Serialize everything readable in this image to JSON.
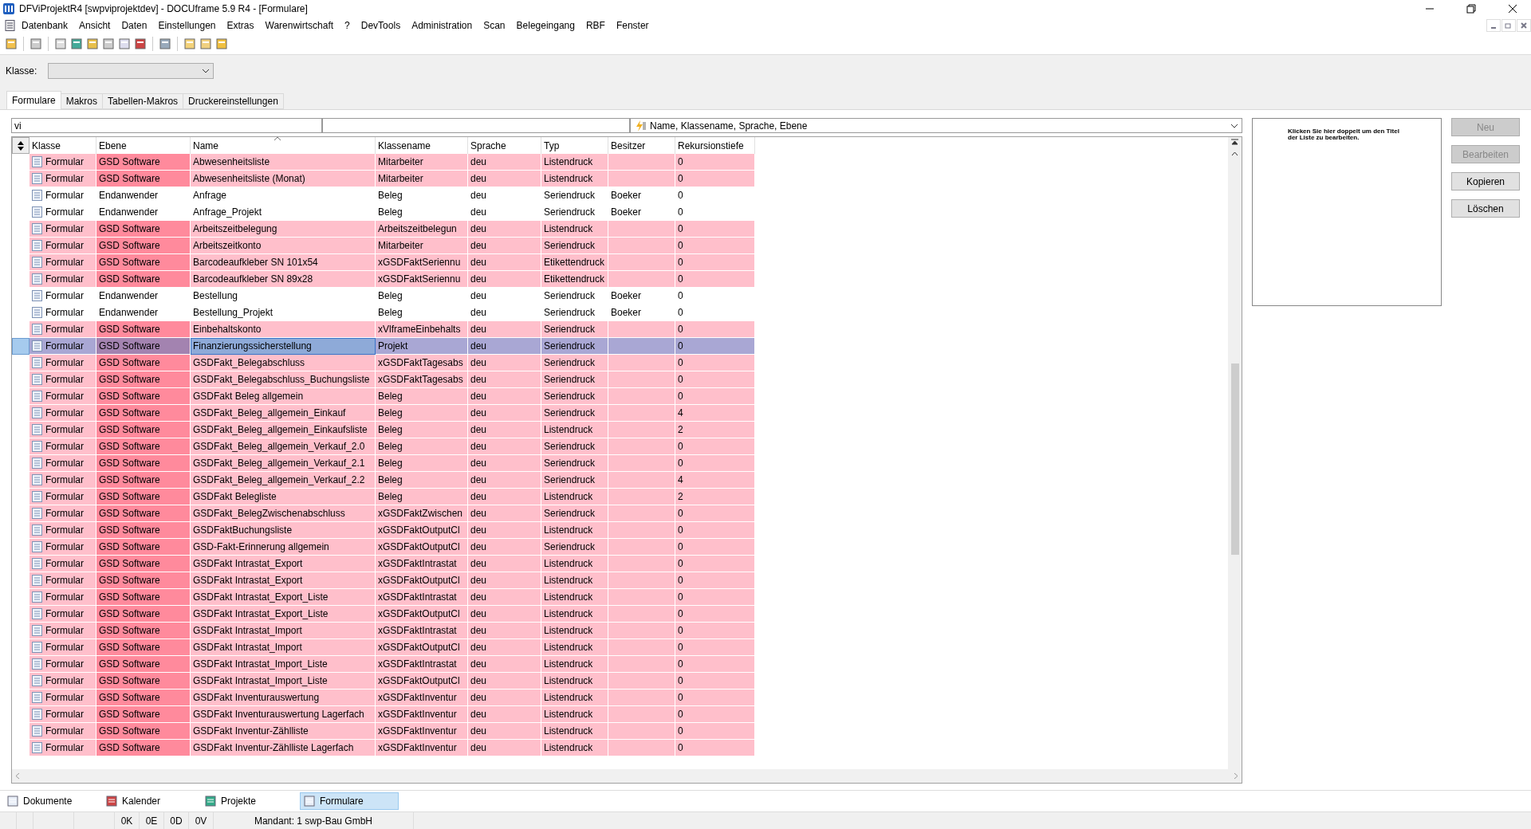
{
  "window": {
    "title": "DFViProjektR4 [swpviprojektdev] - DOCUframe 5.9 R4 - [Formulare]"
  },
  "menu": [
    "Datenbank",
    "Ansicht",
    "Daten",
    "Einstellungen",
    "Extras",
    "Warenwirtschaft",
    "?",
    "DevTools",
    "Administration",
    "Scan",
    "Belegeingang",
    "RBF",
    "Fenster"
  ],
  "klasse": {
    "label": "Klasse:"
  },
  "tabs": [
    {
      "label": "Formulare",
      "selected": true
    },
    {
      "label": "Makros",
      "selected": false
    },
    {
      "label": "Tabellen-Makros",
      "selected": false
    },
    {
      "label": "Druckereinstellungen",
      "selected": false
    }
  ],
  "filter": {
    "value": "vi",
    "fields": "Name, Klassename, Sprache, Ebene"
  },
  "table": {
    "columns": [
      "Klasse",
      "Ebene",
      "Name",
      "Klassename",
      "Sprache",
      "Typ",
      "Besitzer",
      "Rekursionstiefe"
    ],
    "rows": [
      {
        "cells": [
          "Formular",
          "GSD Software",
          "Abwesenheitsliste",
          "Mitarbeiter",
          "deu",
          "Listendruck",
          "",
          "0"
        ],
        "kind": "system",
        "selected": false
      },
      {
        "cells": [
          "Formular",
          "GSD Software",
          "Abwesenheitsliste (Monat)",
          "Mitarbeiter",
          "deu",
          "Listendruck",
          "",
          "0"
        ],
        "kind": "system",
        "selected": false
      },
      {
        "cells": [
          "Formular",
          "Endanwender",
          "Anfrage",
          "Beleg",
          "deu",
          "Seriendruck",
          "Boeker",
          "0"
        ],
        "kind": "user",
        "selected": false
      },
      {
        "cells": [
          "Formular",
          "Endanwender",
          "Anfrage_Projekt",
          "Beleg",
          "deu",
          "Seriendruck",
          "Boeker",
          "0"
        ],
        "kind": "user",
        "selected": false
      },
      {
        "cells": [
          "Formular",
          "GSD Software",
          "Arbeitszeitbelegung",
          "Arbeitszeitbelegun",
          "deu",
          "Listendruck",
          "",
          "0"
        ],
        "kind": "system",
        "selected": false
      },
      {
        "cells": [
          "Formular",
          "GSD Software",
          "Arbeitszeitkonto",
          "Mitarbeiter",
          "deu",
          "Seriendruck",
          "",
          "0"
        ],
        "kind": "system",
        "selected": false
      },
      {
        "cells": [
          "Formular",
          "GSD Software",
          "Barcodeaufkleber SN 101x54",
          "xGSDFaktSeriennu",
          "deu",
          "Etikettendruck",
          "",
          "0"
        ],
        "kind": "system",
        "selected": false
      },
      {
        "cells": [
          "Formular",
          "GSD Software",
          "Barcodeaufkleber SN 89x28",
          "xGSDFaktSeriennu",
          "deu",
          "Etikettendruck",
          "",
          "0"
        ],
        "kind": "system",
        "selected": false
      },
      {
        "cells": [
          "Formular",
          "Endanwender",
          "Bestellung",
          "Beleg",
          "deu",
          "Seriendruck",
          "Boeker",
          "0"
        ],
        "kind": "user",
        "selected": false
      },
      {
        "cells": [
          "Formular",
          "Endanwender",
          "Bestellung_Projekt",
          "Beleg",
          "deu",
          "Seriendruck",
          "Boeker",
          "0"
        ],
        "kind": "user",
        "selected": false
      },
      {
        "cells": [
          "Formular",
          "GSD Software",
          "Einbehaltskonto",
          "xVlframeEinbehalts",
          "deu",
          "Seriendruck",
          "",
          "0"
        ],
        "kind": "system",
        "selected": false
      },
      {
        "cells": [
          "Formular",
          "GSD Software",
          "Finanzierungssicherstellung",
          "Projekt",
          "deu",
          "Seriendruck",
          "",
          "0"
        ],
        "kind": "system",
        "selected": true
      },
      {
        "cells": [
          "Formular",
          "GSD Software",
          "GSDFakt_Belegabschluss",
          "xGSDFaktTagesabs",
          "deu",
          "Seriendruck",
          "",
          "0"
        ],
        "kind": "system",
        "selected": false
      },
      {
        "cells": [
          "Formular",
          "GSD Software",
          "GSDFakt_Belegabschluss_Buchungsliste",
          "xGSDFaktTagesabs",
          "deu",
          "Seriendruck",
          "",
          "0"
        ],
        "kind": "system",
        "selected": false
      },
      {
        "cells": [
          "Formular",
          "GSD Software",
          "GSDFakt Beleg allgemein",
          "Beleg",
          "deu",
          "Seriendruck",
          "",
          "0"
        ],
        "kind": "system",
        "selected": false
      },
      {
        "cells": [
          "Formular",
          "GSD Software",
          "GSDFakt_Beleg_allgemein_Einkauf",
          "Beleg",
          "deu",
          "Seriendruck",
          "",
          "4"
        ],
        "kind": "system",
        "selected": false
      },
      {
        "cells": [
          "Formular",
          "GSD Software",
          "GSDFakt_Beleg_allgemein_Einkaufsliste",
          "Beleg",
          "deu",
          "Listendruck",
          "",
          "2"
        ],
        "kind": "system",
        "selected": false
      },
      {
        "cells": [
          "Formular",
          "GSD Software",
          "GSDFakt_Beleg_allgemein_Verkauf_2.0",
          "Beleg",
          "deu",
          "Seriendruck",
          "",
          "0"
        ],
        "kind": "system",
        "selected": false
      },
      {
        "cells": [
          "Formular",
          "GSD Software",
          "GSDFakt_Beleg_allgemein_Verkauf_2.1",
          "Beleg",
          "deu",
          "Seriendruck",
          "",
          "0"
        ],
        "kind": "system",
        "selected": false
      },
      {
        "cells": [
          "Formular",
          "GSD Software",
          "GSDFakt_Beleg_allgemein_Verkauf_2.2",
          "Beleg",
          "deu",
          "Seriendruck",
          "",
          "4"
        ],
        "kind": "system",
        "selected": false
      },
      {
        "cells": [
          "Formular",
          "GSD Software",
          "GSDFakt Belegliste",
          "Beleg",
          "deu",
          "Listendruck",
          "",
          "2"
        ],
        "kind": "system",
        "selected": false
      },
      {
        "cells": [
          "Formular",
          "GSD Software",
          "GSDFakt_BelegZwischenabschluss",
          "xGSDFaktZwischen",
          "deu",
          "Seriendruck",
          "",
          "0"
        ],
        "kind": "system",
        "selected": false
      },
      {
        "cells": [
          "Formular",
          "GSD Software",
          "GSDFaktBuchungsliste",
          "xGSDFaktOutputCl",
          "deu",
          "Listendruck",
          "",
          "0"
        ],
        "kind": "system",
        "selected": false
      },
      {
        "cells": [
          "Formular",
          "GSD Software",
          "GSD-Fakt-Erinnerung allgemein",
          "xGSDFaktOutputCl",
          "deu",
          "Seriendruck",
          "",
          "0"
        ],
        "kind": "system",
        "selected": false
      },
      {
        "cells": [
          "Formular",
          "GSD Software",
          "GSDFakt Intrastat_Export",
          "xGSDFaktIntrastat",
          "deu",
          "Listendruck",
          "",
          "0"
        ],
        "kind": "system",
        "selected": false
      },
      {
        "cells": [
          "Formular",
          "GSD Software",
          "GSDFakt Intrastat_Export",
          "xGSDFaktOutputCl",
          "deu",
          "Listendruck",
          "",
          "0"
        ],
        "kind": "system",
        "selected": false
      },
      {
        "cells": [
          "Formular",
          "GSD Software",
          "GSDFakt Intrastat_Export_Liste",
          "xGSDFaktIntrastat",
          "deu",
          "Listendruck",
          "",
          "0"
        ],
        "kind": "system",
        "selected": false
      },
      {
        "cells": [
          "Formular",
          "GSD Software",
          "GSDFakt Intrastat_Export_Liste",
          "xGSDFaktOutputCl",
          "deu",
          "Listendruck",
          "",
          "0"
        ],
        "kind": "system",
        "selected": false
      },
      {
        "cells": [
          "Formular",
          "GSD Software",
          "GSDFakt Intrastat_Import",
          "xGSDFaktIntrastat",
          "deu",
          "Listendruck",
          "",
          "0"
        ],
        "kind": "system",
        "selected": false
      },
      {
        "cells": [
          "Formular",
          "GSD Software",
          "GSDFakt Intrastat_Import",
          "xGSDFaktOutputCl",
          "deu",
          "Listendruck",
          "",
          "0"
        ],
        "kind": "system",
        "selected": false
      },
      {
        "cells": [
          "Formular",
          "GSD Software",
          "GSDFakt Intrastat_Import_Liste",
          "xGSDFaktIntrastat",
          "deu",
          "Listendruck",
          "",
          "0"
        ],
        "kind": "system",
        "selected": false
      },
      {
        "cells": [
          "Formular",
          "GSD Software",
          "GSDFakt Intrastat_Import_Liste",
          "xGSDFaktOutputCl",
          "deu",
          "Listendruck",
          "",
          "0"
        ],
        "kind": "system",
        "selected": false
      },
      {
        "cells": [
          "Formular",
          "GSD Software",
          "GSDFakt Inventurauswertung",
          "xGSDFaktInventur",
          "deu",
          "Listendruck",
          "",
          "0"
        ],
        "kind": "system",
        "selected": false
      },
      {
        "cells": [
          "Formular",
          "GSD Software",
          "GSDFakt Inventurauswertung Lagerfach",
          "xGSDFaktInventur",
          "deu",
          "Listendruck",
          "",
          "0"
        ],
        "kind": "system",
        "selected": false
      },
      {
        "cells": [
          "Formular",
          "GSD Software",
          "GSDFakt Inventur-Zählliste",
          "xGSDFaktInventur",
          "deu",
          "Listendruck",
          "",
          "0"
        ],
        "kind": "system",
        "selected": false
      },
      {
        "cells": [
          "Formular",
          "GSD Software",
          "GSDFakt Inventur-Zählliste Lagerfach",
          "xGSDFaktInventur",
          "deu",
          "Listendruck",
          "",
          "0"
        ],
        "kind": "system",
        "selected": false
      }
    ]
  },
  "preview": {
    "text": "Klicken Sie hier doppelt um den Titel der Liste zu bearbeiten."
  },
  "buttons": [
    {
      "label": "Neu",
      "disabled": true
    },
    {
      "label": "Bearbeiten",
      "disabled": true
    },
    {
      "label": "Kopieren",
      "disabled": false
    },
    {
      "label": "Löschen",
      "disabled": false
    }
  ],
  "bottom_tabs": [
    {
      "label": "Dokumente",
      "selected": false
    },
    {
      "label": "Kalender",
      "selected": false
    },
    {
      "label": "Projekte",
      "selected": false
    },
    {
      "label": "Formulare",
      "selected": true
    }
  ],
  "status_bar": [
    "0K",
    "0E",
    "0D",
    "0V",
    "Mandant: 1 swp-Bau GmbH"
  ]
}
